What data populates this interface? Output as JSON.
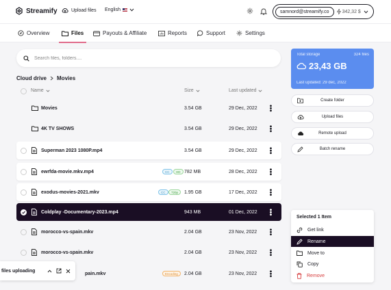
{
  "app": {
    "name": "Streamify"
  },
  "header": {
    "upload_label": "Upload files",
    "language": "English",
    "email": "samnord@streamify.co",
    "balance": "342,32 $"
  },
  "tabs": [
    {
      "label": "Overview",
      "icon": "compass-icon"
    },
    {
      "label": "Files",
      "icon": "folder-icon",
      "active": true
    },
    {
      "label": "Payouts & Affiliate",
      "icon": "wallet-icon"
    },
    {
      "label": "Reports",
      "icon": "chart-icon"
    },
    {
      "label": "Support",
      "icon": "chat-icon"
    },
    {
      "label": "Settings",
      "icon": "gear-icon"
    }
  ],
  "search": {
    "placeholder": "Search files, folders...."
  },
  "breadcrumb": {
    "root": "Cloud drive",
    "current": "Movies"
  },
  "table": {
    "columns": {
      "name": "Name",
      "size": "Size",
      "date": "Last updated"
    },
    "rows": [
      {
        "type": "folder",
        "name": "Movies",
        "size": "3.54 GB",
        "date": "29 Dec, 2022"
      },
      {
        "type": "folder",
        "name": "4K TV SHOWS",
        "size": "3.54 GB",
        "date": "29 Dec, 2022"
      },
      {
        "type": "file",
        "name": "Superman 2023 1080P.mp4",
        "size": "3.54 GB",
        "date": "29 Dec, 2022"
      },
      {
        "type": "file",
        "name": "ewrfda-movie.mkv.mp4",
        "size": "782 MB",
        "date": "28 Dec, 2022",
        "badges": [
          "CC",
          "HD"
        ]
      },
      {
        "type": "file",
        "name": "exodus-movies-2021.mkv",
        "size": "1.95 GB",
        "date": "17 Dec, 2022",
        "badges": [
          "CC",
          "720p"
        ]
      },
      {
        "type": "file",
        "name": "Coldplay -Documentary-2023.mp4",
        "size": "943 MB",
        "date": "01 Dec, 2022",
        "selected": true
      },
      {
        "type": "file",
        "name": "morocco-vs-spain.mkv",
        "size": "2.04 GB",
        "date": "23 Nov, 2022"
      },
      {
        "type": "file",
        "name": "morocco-vs-spain.mkv",
        "size": "2.04 GB",
        "date": "23 Nov, 2022"
      },
      {
        "type": "file",
        "name": "pain.mkv",
        "size": "2.04 GB",
        "date": "23 Nov, 2022",
        "badges": [
          "Encoding"
        ]
      }
    ]
  },
  "storage": {
    "label": "Total storage",
    "files": "324 files",
    "value": "23,43 GB",
    "updated": "Last updated: 29 dec, 2022"
  },
  "actions": [
    "Create folder",
    "Upload files",
    "Remote upload",
    "Batch rename"
  ],
  "context_menu": {
    "title": "Selected 1 Item",
    "items": [
      "Get link",
      "Rename",
      "Move to",
      "Copy",
      "Remove"
    ]
  },
  "upload_toast": {
    "label": "files uploading"
  },
  "colors": {
    "accent": "#5b8def",
    "selected_row": "#1a0e24",
    "tab_underline": "#e06a8a",
    "danger": "#d63b3b"
  }
}
